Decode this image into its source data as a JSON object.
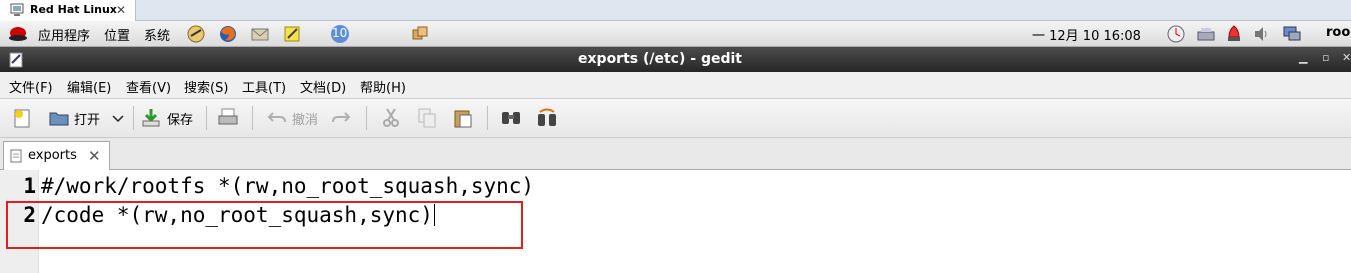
{
  "vm_tab": {
    "title": "Red Hat Linux",
    "close": "✕"
  },
  "panel": {
    "applications": "应用程序",
    "places": "位置",
    "system": "系统",
    "workspace_badge": "10",
    "clock": "一 12月 10 16:08",
    "user": "roo"
  },
  "window": {
    "title": "exports (/etc) - gedit"
  },
  "menubar": {
    "file": "文件(F)",
    "edit": "编辑(E)",
    "view": "查看(V)",
    "search": "搜索(S)",
    "tools": "工具(T)",
    "documents": "文档(D)",
    "help": "帮助(H)"
  },
  "toolbar": {
    "open": "打开",
    "save": "保存",
    "undo": "撤消"
  },
  "document_tab": {
    "name": "exports"
  },
  "editor": {
    "lines": [
      {
        "number": "1",
        "text": "#/work/rootfs *(rw,no_root_squash,sync)"
      },
      {
        "number": "2",
        "text": "/code *(rw,no_root_squash,sync)"
      }
    ]
  },
  "colors": {
    "highlight": "#e02020",
    "titlebar": "#333333"
  }
}
